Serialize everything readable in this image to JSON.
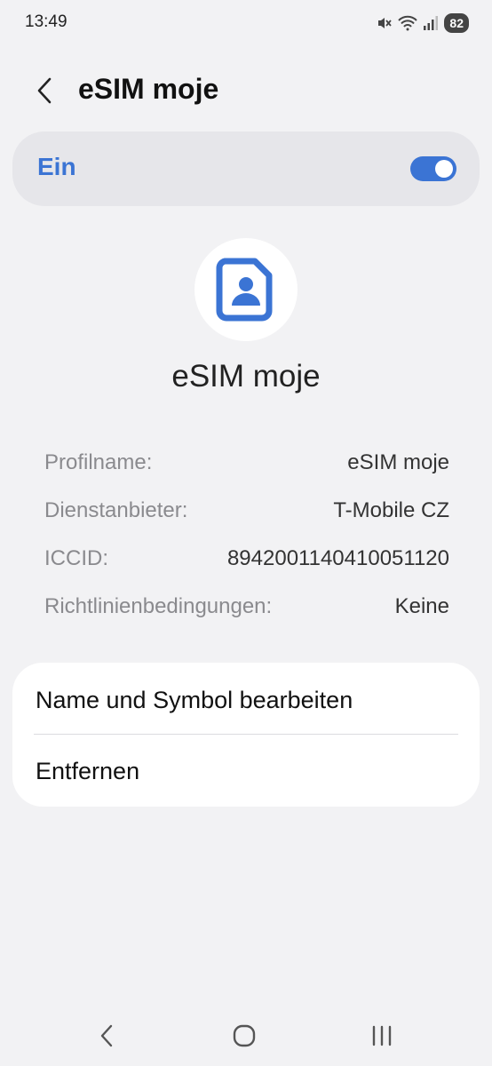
{
  "status_bar": {
    "time": "13:49",
    "battery": "82",
    "icons": [
      "mute-icon",
      "wifi-icon",
      "signal-icon"
    ]
  },
  "header": {
    "title": "eSIM moje",
    "back_icon": "back-arrow-icon"
  },
  "toggle": {
    "label": "Ein",
    "state": "on",
    "accent_color": "#3b74d4"
  },
  "profile": {
    "icon": "sim-card-person-icon",
    "name": "eSIM moje"
  },
  "info": [
    {
      "key": "Profilname:",
      "value": "eSIM moje"
    },
    {
      "key": "Dienstanbieter:",
      "value": "T-Mobile CZ"
    },
    {
      "key": "ICCID:",
      "value": "8942001140410051120"
    },
    {
      "key": "Richtlinienbedingungen:",
      "value": "Keine"
    }
  ],
  "actions": [
    {
      "label": "Name und Symbol bearbeiten"
    },
    {
      "label": "Entfernen"
    }
  ],
  "nav_bar": {
    "icons": [
      "back-icon",
      "home-icon",
      "recents-icon"
    ]
  }
}
